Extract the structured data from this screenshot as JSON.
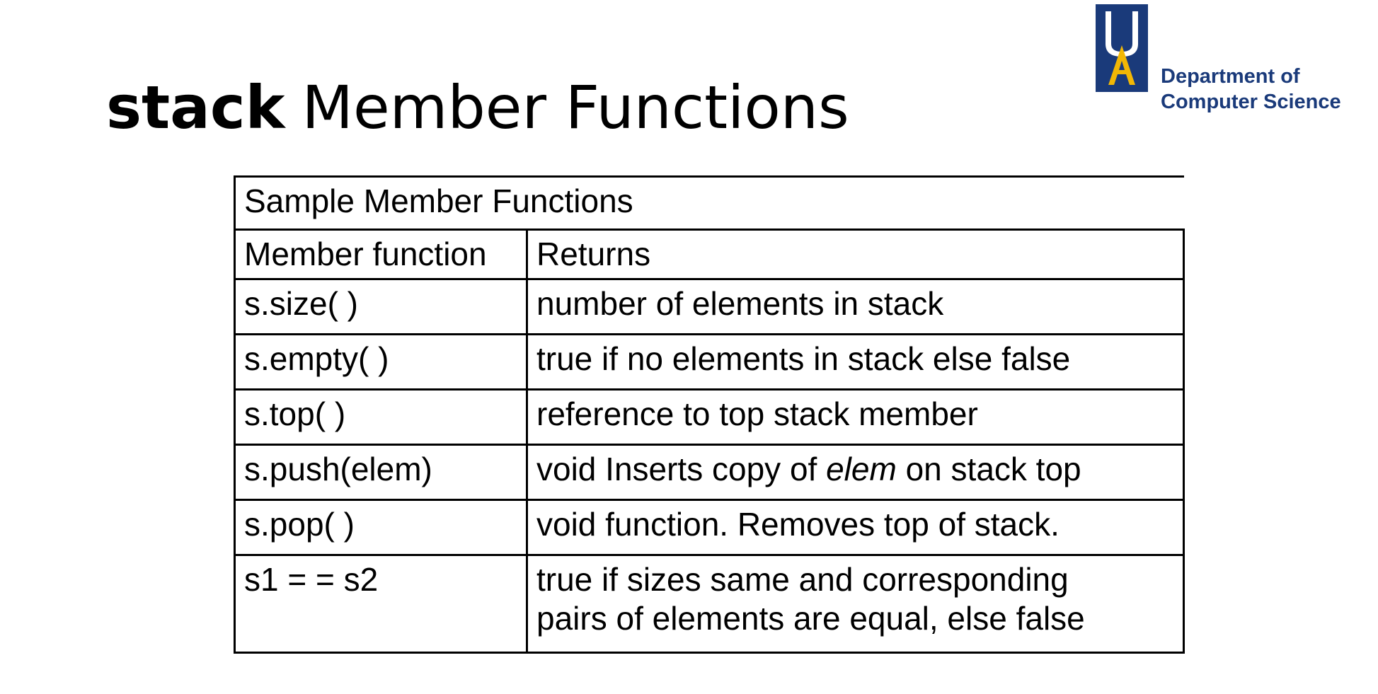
{
  "slide": {
    "title_code": "stack",
    "title_rest": "Member Functions"
  },
  "logo": {
    "line1": "Department of",
    "line2": "Computer Science",
    "mark_colors": {
      "background": "#1a3a7a",
      "letter_u": "#ffffff",
      "letter_a": "#f2b705"
    }
  },
  "table": {
    "caption": "Sample Member Functions",
    "headers": [
      "Member function",
      "Returns"
    ],
    "rows": [
      {
        "function": "s.size( )",
        "returns": "number of elements in stack"
      },
      {
        "function": "s.empty( )",
        "returns": "true if no elements in stack else false"
      },
      {
        "function": "s.top( )",
        "returns": "reference to top stack member"
      },
      {
        "function": "s.push(elem)",
        "returns_pre": "void Inserts copy of ",
        "returns_em": "elem",
        "returns_post": " on stack top"
      },
      {
        "function": "s.pop( )",
        "returns": "void function. Removes top of stack."
      },
      {
        "function": "s1 = = s2",
        "returns_line1": "true if sizes same and corresponding",
        "returns_line2": "pairs of elements are equal, else false"
      }
    ]
  }
}
